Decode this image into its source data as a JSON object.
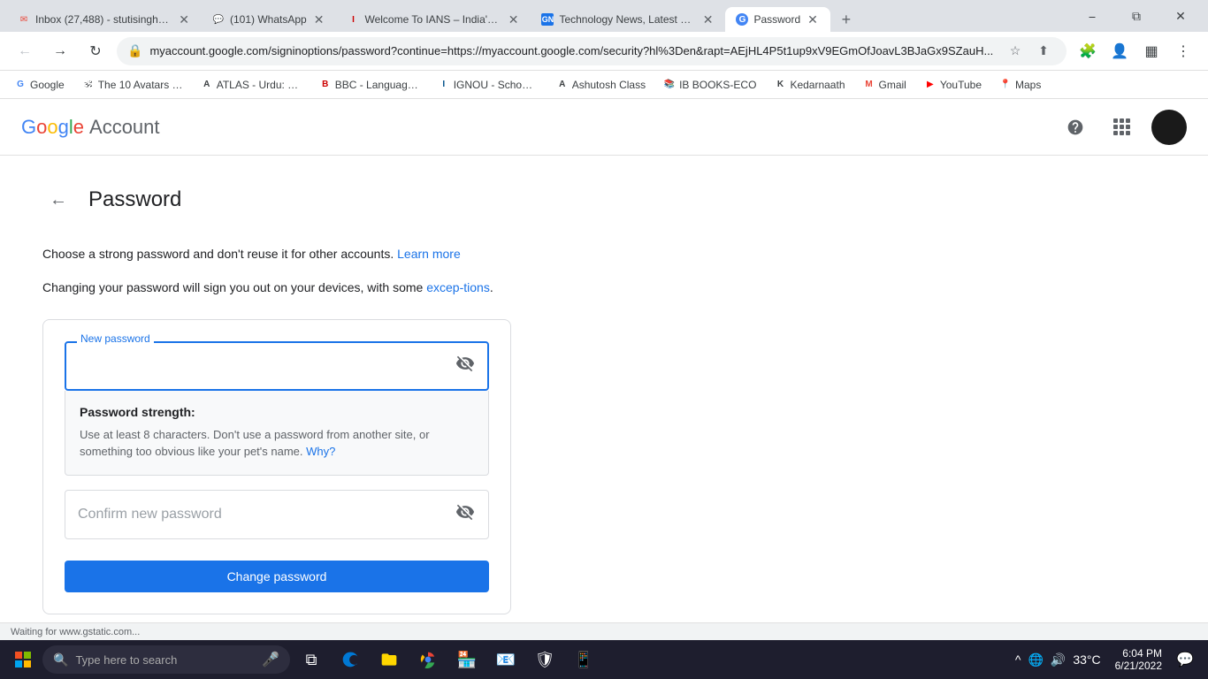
{
  "browser": {
    "tabs": [
      {
        "id": "tab1",
        "favicon": "✉",
        "favicon_color": "#ea4335",
        "title": "Inbox (27,488) - stutisingh22...",
        "active": false
      },
      {
        "id": "tab2",
        "favicon": "💬",
        "favicon_color": "#25d366",
        "title": "(101) WhatsApp",
        "active": false
      },
      {
        "id": "tab3",
        "favicon": "I",
        "favicon_color": "#c00",
        "title": "Welcome To IANS – India's L...",
        "active": false
      },
      {
        "id": "tab4",
        "favicon": "GN",
        "favicon_color": "#333",
        "title": "Technology News, Latest & ...",
        "active": false
      },
      {
        "id": "tab5",
        "favicon": "G",
        "favicon_color": "#4285f4",
        "title": "Password",
        "active": true
      }
    ],
    "address_bar": {
      "url": "myaccount.google.com/signinoptions/password?continue=https://myaccount.google.com/security?hl%3Den&rapt=AEjHL4P5t1up9xV9EGmOfJoavL3BJaGx9SZauH...",
      "secure": true
    },
    "bookmarks": [
      {
        "label": "Google",
        "favicon": "G"
      },
      {
        "label": "The 10 Avatars of t...",
        "favicon": "🕉"
      },
      {
        "label": "ATLAS - Urdu: Urdu...",
        "favicon": "A"
      },
      {
        "label": "BBC - Languages - ...",
        "favicon": "B"
      },
      {
        "label": "IGNOU - School of...",
        "favicon": "I"
      },
      {
        "label": "Ashutosh Class",
        "favicon": "A"
      },
      {
        "label": "IB BOOKS-ECO",
        "favicon": "📚"
      },
      {
        "label": "Kedarnaath",
        "favicon": "K"
      },
      {
        "label": "Gmail",
        "favicon": "M"
      },
      {
        "label": "YouTube",
        "favicon": "▶"
      },
      {
        "label": "Maps",
        "favicon": "📍"
      }
    ],
    "status": "Waiting for www.gstatic.com..."
  },
  "header": {
    "google_text": "Google",
    "account_text": "Account",
    "help_tooltip": "Help",
    "apps_tooltip": "Google apps"
  },
  "page": {
    "back_label": "←",
    "title": "Password",
    "description1": "Choose a strong password and don't reuse it for other accounts.",
    "learn_more": "Learn more",
    "description2": "Changing your password will sign you out on your devices, with some",
    "exceptions_link": "excep-tions",
    "exceptions_period": ".",
    "new_password_label": "New password",
    "confirm_password_placeholder": "Confirm new password",
    "strength_title": "Password strength:",
    "strength_desc": "Use at least 8 characters. Don't use a password from another site, or something too obvious like your pet's name.",
    "why_link": "Why?",
    "change_button": "Change password"
  },
  "taskbar": {
    "search_placeholder": "Type here to search",
    "time": "6:04 PM",
    "date": "6/21/2022",
    "temperature": "33°C"
  }
}
